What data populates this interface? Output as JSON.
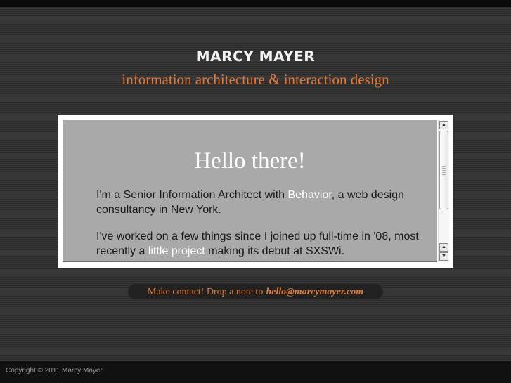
{
  "header": {
    "site_name": "MARCY MAYER",
    "tagline": "information architecture & interaction design"
  },
  "panel": {
    "heading": "Hello there!",
    "para1": {
      "before": "I'm a Senior Information Architect with ",
      "link": "Behavior",
      "after": ", a web design consultancy in New York."
    },
    "para2": {
      "before": "I've worked on a few things since I joined up full-time in '08, most recently a ",
      "link1": "little",
      "space": " ",
      "link2": "project",
      "after": " making its debut at SXSWi."
    }
  },
  "contact": {
    "text": "Make contact! Drop a note to",
    "email": "hello@marcymayer.com"
  },
  "footer": {
    "copyright": "Copyright © 2011 Marcy Mayer"
  },
  "colors": {
    "accent": "#e0793c",
    "panel_bg": "#a9a9a9",
    "page_bg": "#333333"
  }
}
